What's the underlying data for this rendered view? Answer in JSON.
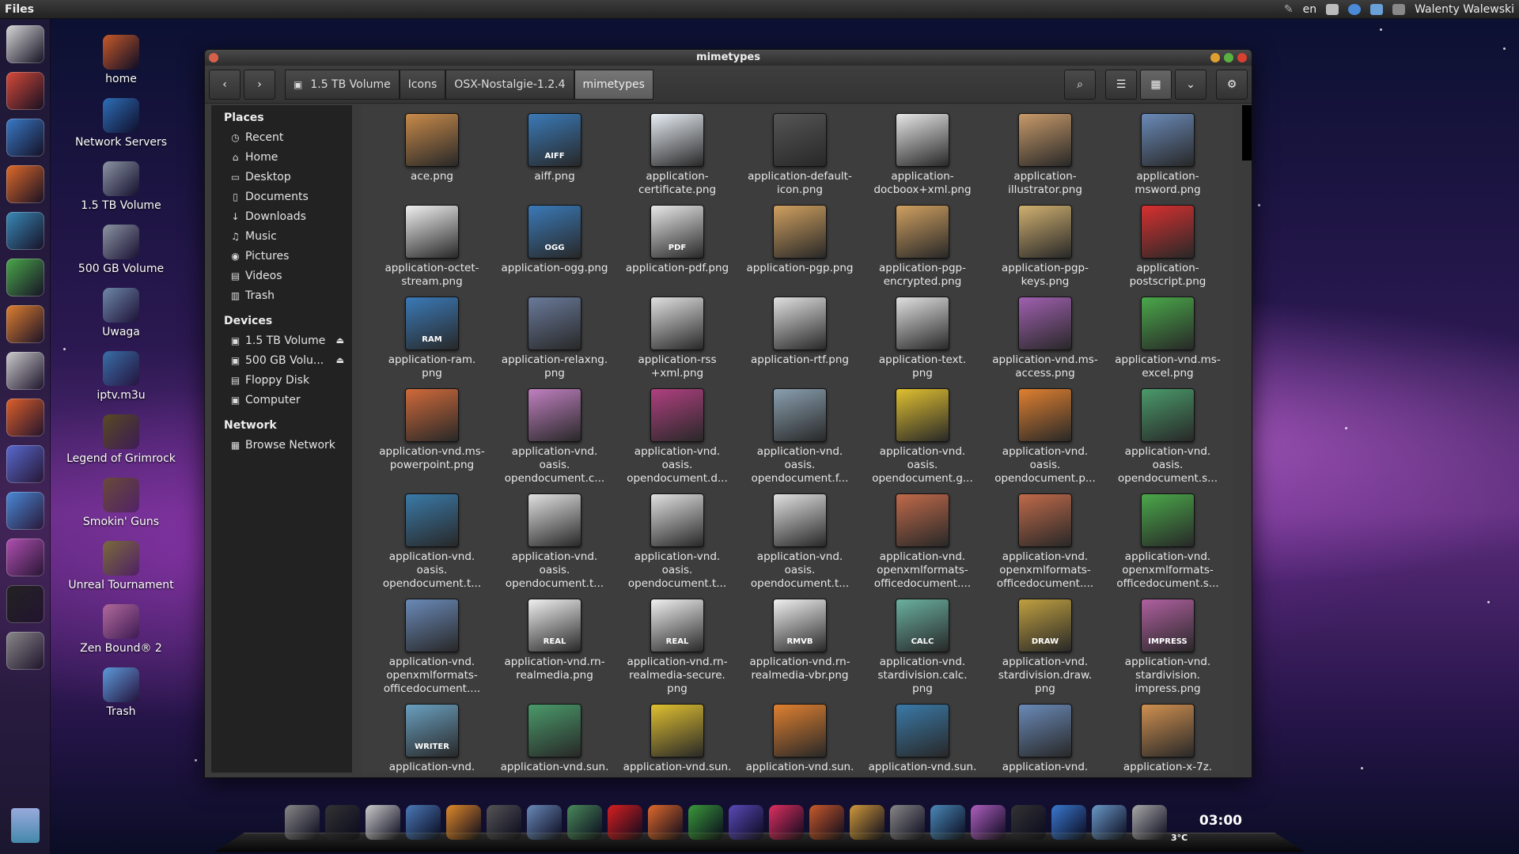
{
  "top_panel": {
    "app_name": "Files",
    "keyboard_layout": "en",
    "user_name": "Walenty Walewski"
  },
  "desktop_icons": [
    {
      "label": "home",
      "color": "#c85a2a"
    },
    {
      "label": "Network Servers",
      "color": "#2e6fb8"
    },
    {
      "label": "1.5 TB Volume",
      "color": "#8d95a4"
    },
    {
      "label": "500 GB Volume",
      "color": "#8d95a4"
    },
    {
      "label": "Uwaga",
      "color": "#6f88a8"
    },
    {
      "label": "iptv.m3u",
      "color": "#3a6fa8"
    },
    {
      "label": "Legend of Grimrock",
      "color": "#5b4a24"
    },
    {
      "label": "Smokin' Guns",
      "color": "#6b4a3a"
    },
    {
      "label": "Unreal Tournament",
      "color": "#7a6a3a"
    },
    {
      "label": "Zen Bound® 2",
      "color": "#b06a9a"
    },
    {
      "label": "Trash",
      "color": "#5b9ad8"
    }
  ],
  "window": {
    "title": "mimetypes",
    "breadcrumbs": [
      "1.5 TB Volume",
      "Icons",
      "OSX-Nostalgie-1.2.4",
      "mimetypes"
    ]
  },
  "sidebar": {
    "places_header": "Places",
    "places": [
      {
        "label": "Recent",
        "icon": "clock-icon",
        "glyph": "◷"
      },
      {
        "label": "Home",
        "icon": "home-icon",
        "glyph": "⌂"
      },
      {
        "label": "Desktop",
        "icon": "folder-icon",
        "glyph": "▭"
      },
      {
        "label": "Documents",
        "icon": "document-icon",
        "glyph": "▯"
      },
      {
        "label": "Downloads",
        "icon": "download-icon",
        "glyph": "↓"
      },
      {
        "label": "Music",
        "icon": "music-icon",
        "glyph": "♫"
      },
      {
        "label": "Pictures",
        "icon": "camera-icon",
        "glyph": "◉"
      },
      {
        "label": "Videos",
        "icon": "film-icon",
        "glyph": "▤"
      },
      {
        "label": "Trash",
        "icon": "trash-icon",
        "glyph": "▥"
      }
    ],
    "devices_header": "Devices",
    "devices": [
      {
        "label": "1.5 TB Volume",
        "icon": "drive-icon",
        "glyph": "▣",
        "eject": "⏏"
      },
      {
        "label": "500 GB Volu...",
        "icon": "drive-icon",
        "glyph": "▣",
        "eject": "⏏"
      },
      {
        "label": "Floppy Disk",
        "icon": "floppy-icon",
        "glyph": "▤",
        "eject": ""
      },
      {
        "label": "Computer",
        "icon": "computer-icon",
        "glyph": "▣",
        "eject": ""
      }
    ],
    "network_header": "Network",
    "network": [
      {
        "label": "Browse Network",
        "icon": "network-icon",
        "glyph": "▦"
      }
    ]
  },
  "files": [
    {
      "name": "ace.png",
      "color": "#c88a4a",
      "tag": ""
    },
    {
      "name": "aiff.png",
      "color": "#3a7ab8",
      "tag": "AIFF"
    },
    {
      "name": "application-\ncertificate.png",
      "color": "#e8eef5",
      "tag": ""
    },
    {
      "name": "application-default-\nicon.png",
      "color": "#555",
      "tag": ""
    },
    {
      "name": "application-\ndocboox+xml.png",
      "color": "#e6e6e6",
      "tag": ""
    },
    {
      "name": "application-\nillustrator.png",
      "color": "#c89a6a",
      "tag": ""
    },
    {
      "name": "application-\nmsword.png",
      "color": "#6a8ab8",
      "tag": ""
    },
    {
      "name": "application-octet-\nstream.png",
      "color": "#f0f0f0",
      "tag": ""
    },
    {
      "name": "application-ogg.png",
      "color": "#3a7ab8",
      "tag": "OGG"
    },
    {
      "name": "application-pdf.png",
      "color": "#e8e8e8",
      "tag": "PDF"
    },
    {
      "name": "application-pgp.png",
      "color": "#d0a060",
      "tag": ""
    },
    {
      "name": "application-pgp-\nencrypted.png",
      "color": "#d0a060",
      "tag": ""
    },
    {
      "name": "application-pgp-\nkeys.png",
      "color": "#d0b070",
      "tag": ""
    },
    {
      "name": "application-\npostscript.png",
      "color": "#d83030",
      "tag": ""
    },
    {
      "name": "application-ram.\npng",
      "color": "#3a7ab8",
      "tag": "RAM"
    },
    {
      "name": "application-relaxng.\npng",
      "color": "#6a7a9a",
      "tag": ""
    },
    {
      "name": "application-rss\n+xml.png",
      "color": "#e0e0e0",
      "tag": ""
    },
    {
      "name": "application-rtf.png",
      "color": "#e0e0e0",
      "tag": ""
    },
    {
      "name": "application-text.\npng",
      "color": "#e0e0e0",
      "tag": ""
    },
    {
      "name": "application-vnd.ms-\naccess.png",
      "color": "#a060b0",
      "tag": ""
    },
    {
      "name": "application-vnd.ms-\nexcel.png",
      "color": "#4aa84a",
      "tag": ""
    },
    {
      "name": "application-vnd.ms-\npowerpoint.png",
      "color": "#d06a3a",
      "tag": ""
    },
    {
      "name": "application-vnd.\noasis.\nopendocument.c...",
      "color": "#c080c0",
      "tag": ""
    },
    {
      "name": "application-vnd.\noasis.\nopendocument.d...",
      "color": "#b04080",
      "tag": ""
    },
    {
      "name": "application-vnd.\noasis.\nopendocument.f...",
      "color": "#8aa0b0",
      "tag": ""
    },
    {
      "name": "application-vnd.\noasis.\nopendocument.g...",
      "color": "#e0c030",
      "tag": ""
    },
    {
      "name": "application-vnd.\noasis.\nopendocument.p...",
      "color": "#e08030",
      "tag": ""
    },
    {
      "name": "application-vnd.\noasis.\nopendocument.s...",
      "color": "#4a9a6a",
      "tag": ""
    },
    {
      "name": "application-vnd.\noasis.\nopendocument.t...",
      "color": "#3a7aa8",
      "tag": ""
    },
    {
      "name": "application-vnd.\noasis.\nopendocument.t...",
      "color": "#e0e0e0",
      "tag": ""
    },
    {
      "name": "application-vnd.\noasis.\nopendocument.t...",
      "color": "#e0e0e0",
      "tag": ""
    },
    {
      "name": "application-vnd.\noasis.\nopendocument.t...",
      "color": "#e0e0e0",
      "tag": ""
    },
    {
      "name": "application-vnd.\nopenxmlformats-\nofficedocument....",
      "color": "#c06a4a",
      "tag": ""
    },
    {
      "name": "application-vnd.\nopenxmlformats-\nofficedocument....",
      "color": "#c06a4a",
      "tag": ""
    },
    {
      "name": "application-vnd.\nopenxmlformats-\nofficedocument.s...",
      "color": "#4aa84a",
      "tag": ""
    },
    {
      "name": "application-vnd.\nopenxmlformats-\nofficedocument....",
      "color": "#6a8ab8",
      "tag": ""
    },
    {
      "name": "application-vnd.rn-\nrealmedia.png",
      "color": "#f0f0f0",
      "tag": "REAL"
    },
    {
      "name": "application-vnd.rn-\nrealmedia-secure.\npng",
      "color": "#f0f0f0",
      "tag": "REAL"
    },
    {
      "name": "application-vnd.rn-\nrealmedia-vbr.png",
      "color": "#f0f0f0",
      "tag": "RMVB"
    },
    {
      "name": "application-vnd.\nstardivision.calc.\npng",
      "color": "#6ab0a0",
      "tag": "CALC"
    },
    {
      "name": "application-vnd.\nstardivision.draw.\npng",
      "color": "#c0a040",
      "tag": "DRAW"
    },
    {
      "name": "application-vnd.\nstardivision.\nimpress.png",
      "color": "#b060a0",
      "tag": "IMPRESS"
    },
    {
      "name": "application-vnd.",
      "color": "#6aa0c0",
      "tag": "WRITER"
    },
    {
      "name": "application-vnd.sun.",
      "color": "#4a9a6a",
      "tag": ""
    },
    {
      "name": "application-vnd.sun.",
      "color": "#e0c030",
      "tag": ""
    },
    {
      "name": "application-vnd.sun.",
      "color": "#e08030",
      "tag": ""
    },
    {
      "name": "application-vnd.sun.",
      "color": "#3a7aa8",
      "tag": ""
    },
    {
      "name": "application-vnd.",
      "color": "#6a8ab8",
      "tag": ""
    },
    {
      "name": "application-x-7z.",
      "color": "#d09050",
      "tag": ""
    }
  ],
  "launcher_colors": [
    "#d8d8d8",
    "#d84a3a",
    "#3a7ac8",
    "#e06a2a",
    "#3a8ab8",
    "#4aa84a",
    "#e08030",
    "#ccc",
    "#e0602a",
    "#5a6ad0",
    "#4a8ad8",
    "#b050b0",
    "#222",
    "#888"
  ],
  "dock_colors": [
    "#888",
    "#333",
    "#ccc",
    "#4a7ab8",
    "#e08a2a",
    "#555",
    "#6a8ab8",
    "#4a8a5a",
    "#d82020",
    "#e06a2a",
    "#3a9a3a",
    "#5a4ab8",
    "#e03060",
    "#c85a2a",
    "#d09a3a",
    "#888",
    "#4a8ab8",
    "#b060c0",
    "#333",
    "#3a7ad0",
    "#6a9ac8",
    "#aaa"
  ],
  "clock": "03:00",
  "weather": "3°C"
}
